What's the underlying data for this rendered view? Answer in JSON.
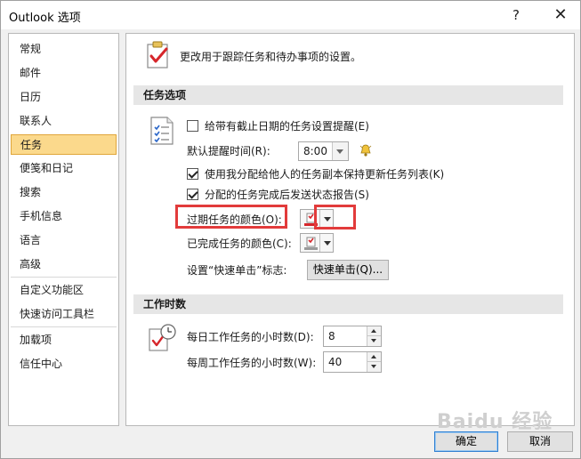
{
  "window": {
    "title": "Outlook 选项",
    "help_glyph": "?",
    "close_glyph": "✕"
  },
  "sidebar": {
    "items": [
      {
        "label": "常规"
      },
      {
        "label": "邮件"
      },
      {
        "label": "日历"
      },
      {
        "label": "联系人"
      },
      {
        "label": "任务",
        "selected": true
      },
      {
        "label": "便笺和日记"
      },
      {
        "label": "搜索"
      },
      {
        "label": "手机信息"
      },
      {
        "label": "语言"
      },
      {
        "label": "高级"
      },
      {
        "label": "自定义功能区"
      },
      {
        "label": "快速访问工具栏"
      },
      {
        "label": "加载项"
      },
      {
        "label": "信任中心"
      }
    ]
  },
  "main": {
    "header_text": "更改用于跟踪任务和待办事项的设置。",
    "task_options": {
      "section_title": "任务选项",
      "reminder_checkbox": {
        "label": "给带有截止日期的任务设置提醒(E)",
        "checked": false
      },
      "default_reminder_time": {
        "label": "默认提醒时间(R):",
        "value": "8:00"
      },
      "keep_updated_checkbox": {
        "label": "使用我分配给他人的任务副本保持更新任务列表(K)",
        "checked": true
      },
      "status_report_checkbox": {
        "label": "分配的任务完成后发送状态报告(S)",
        "checked": true
      },
      "overdue_color": {
        "label": "过期任务的颜色(O):"
      },
      "completed_color": {
        "label": "已完成任务的颜色(C):"
      },
      "quick_click": {
        "label": "设置“快速单击”标志:",
        "button_label": "快速单击(Q)..."
      }
    },
    "work_hours": {
      "section_title": "工作时数",
      "daily_hours": {
        "label": "每日工作任务的小时数(D):",
        "value": "8"
      },
      "weekly_hours": {
        "label": "每周工作任务的小时数(W):",
        "value": "40"
      }
    }
  },
  "footer": {
    "ok_label": "确定",
    "cancel_label": "取消"
  },
  "watermark": "Baidu 经验",
  "colors": {
    "selected_bg": "#fbd98c",
    "selected_border": "#e0a63a",
    "annotation_red": "#e23b3b",
    "section_bg": "#e6e6e6"
  },
  "icons": {
    "header": "task-clipboard-icon",
    "task_options": "task-list-icon",
    "work_hours": "clock-task-icon",
    "bell": "bell-icon"
  }
}
